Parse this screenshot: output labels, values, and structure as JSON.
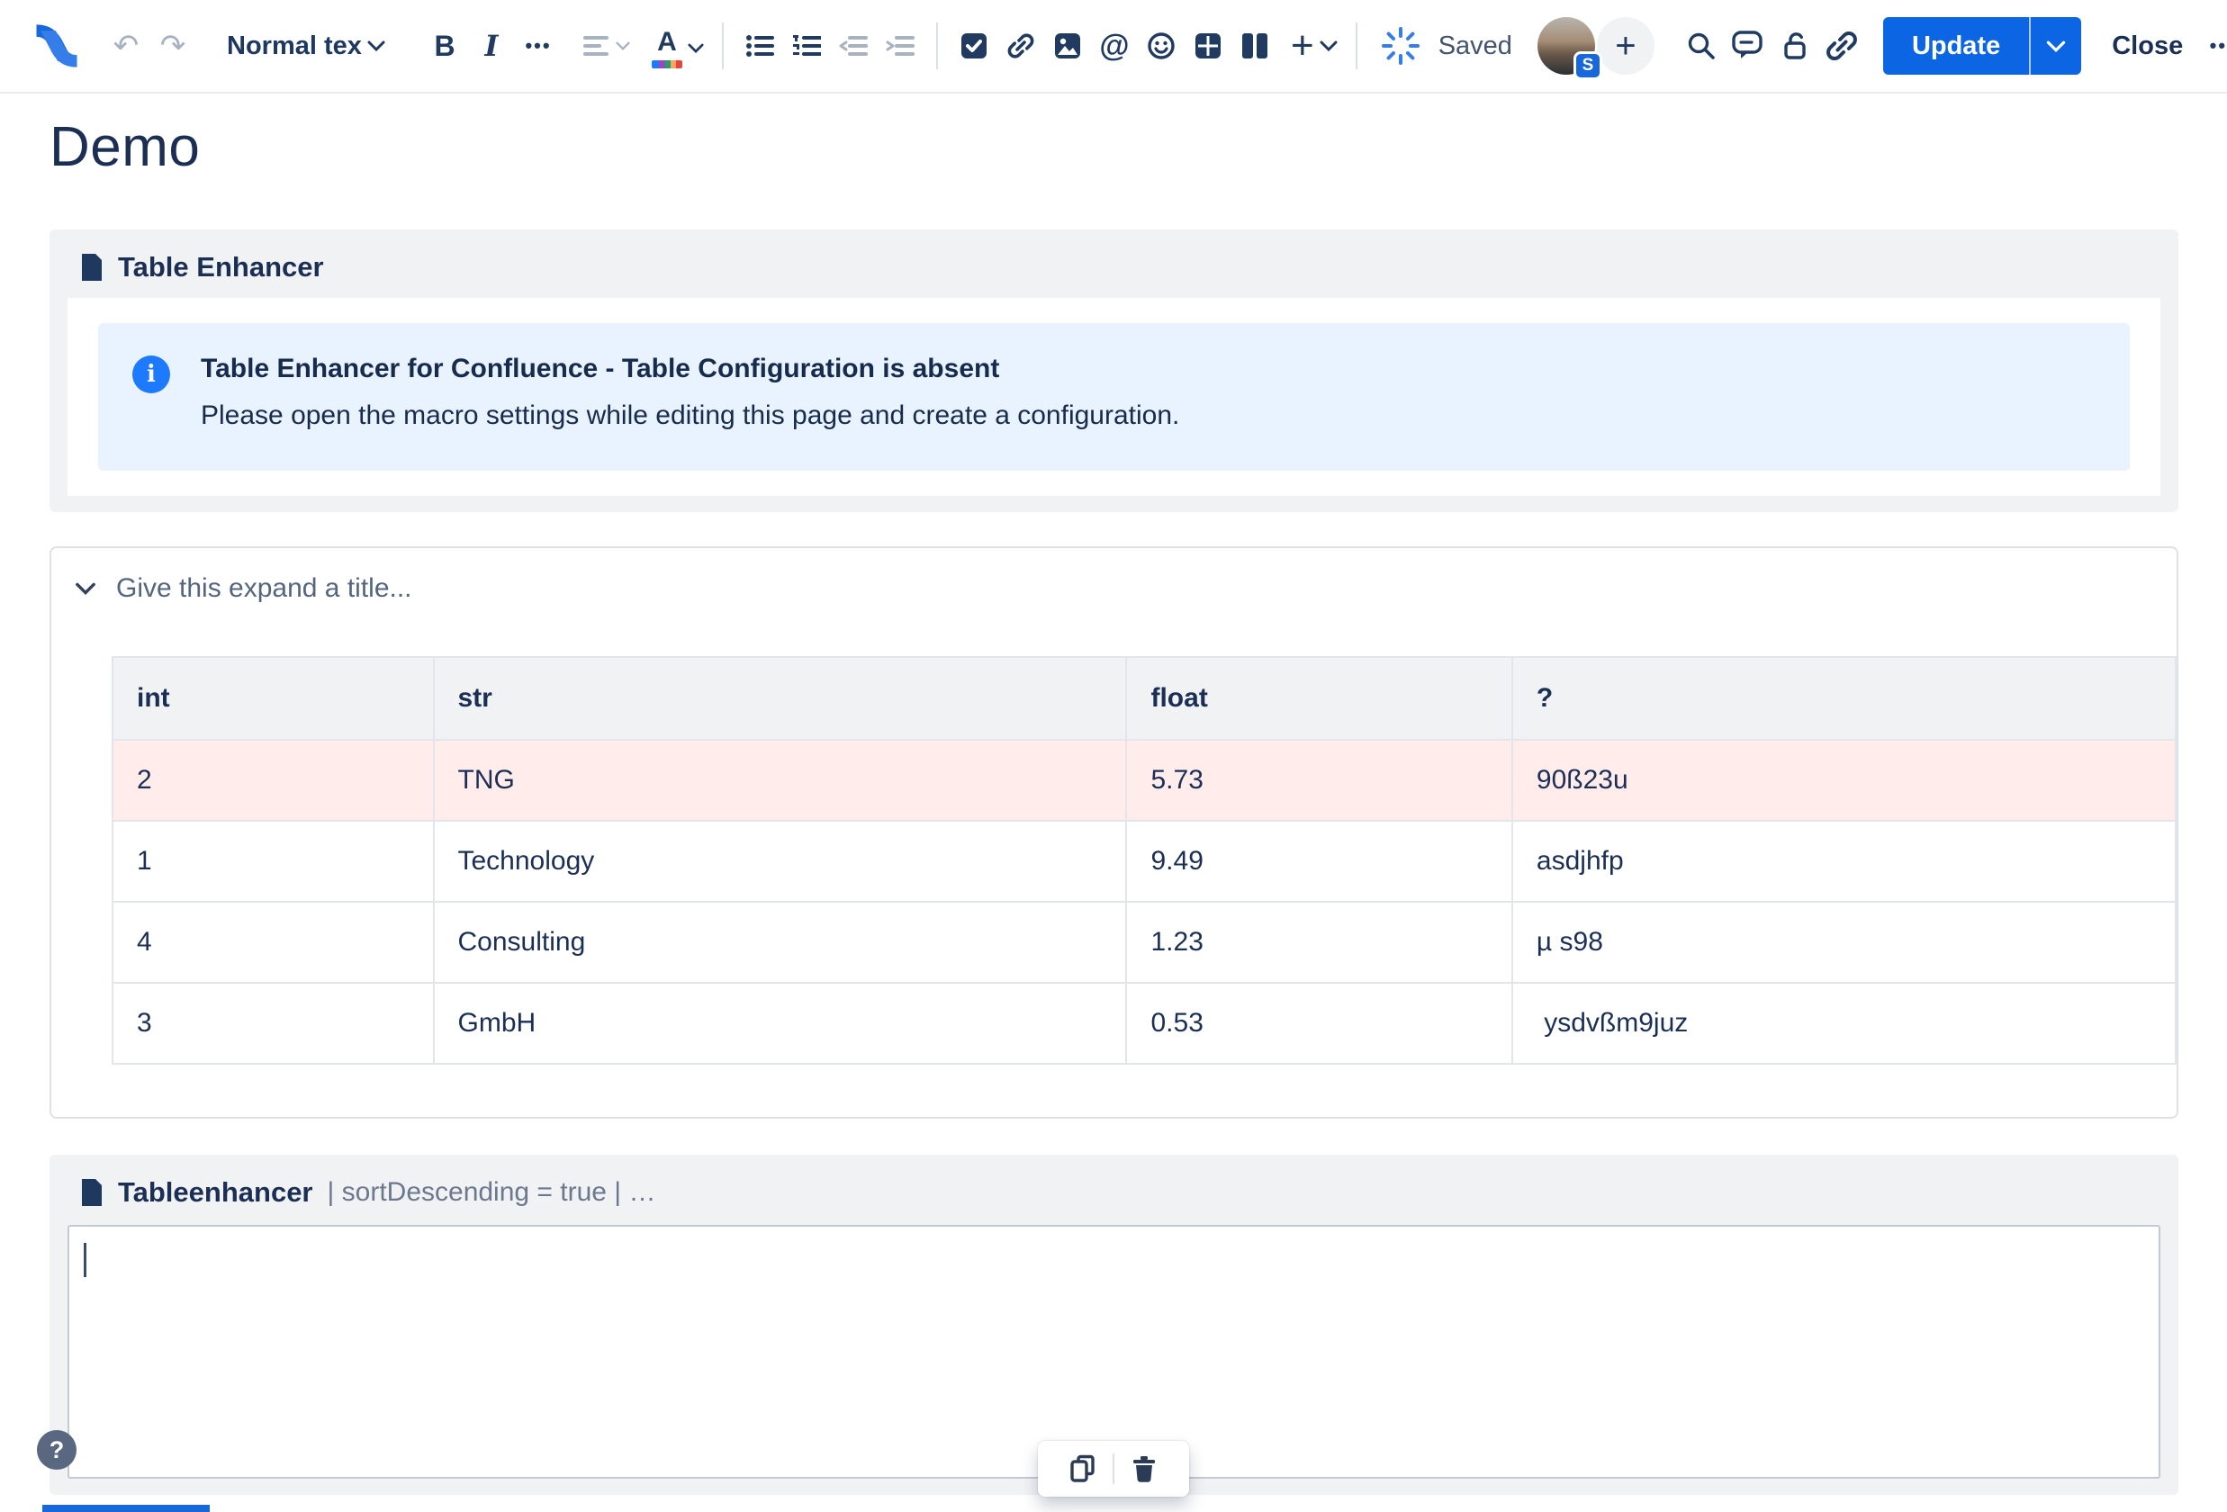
{
  "toolbar": {
    "undo_glyph": "↶",
    "redo_glyph": "↷",
    "text_style_label": "Normal text",
    "bold_label": "B",
    "italic_label": "I",
    "more_formatting_label": "•••",
    "text_color_label": "A",
    "mention_label": "@",
    "plus_label": "+",
    "saved_label": "Saved",
    "avatar_badge": "S",
    "add_collaborator_label": "+",
    "update_label": "Update",
    "close_label": "Close",
    "overflow_label": "•••"
  },
  "page": {
    "title": "Demo"
  },
  "table_enhancer_macro": {
    "name": "Table Enhancer",
    "info": {
      "icon_glyph": "i",
      "title": "Table Enhancer for Confluence - Table Configuration is absent",
      "body": "Please open the macro settings while editing this page and create a configuration."
    }
  },
  "expand": {
    "title_placeholder": "Give this expand a title..."
  },
  "data_table": {
    "headers": [
      "int",
      "str",
      "float",
      "?"
    ],
    "rows": [
      {
        "cells": [
          "2",
          "TNG",
          "5.73",
          "90ß23u"
        ],
        "highlighted": true
      },
      {
        "cells": [
          "1",
          "Technology",
          "9.49",
          "asdjhfp"
        ],
        "highlighted": false
      },
      {
        "cells": [
          "4",
          "Consulting",
          "1.23",
          "µ s98"
        ],
        "highlighted": false
      },
      {
        "cells": [
          "3",
          "GmbH",
          "0.53",
          " ysdvßm9juz"
        ],
        "highlighted": false
      }
    ]
  },
  "tableenhancer_macro": {
    "name": "Tableenhancer",
    "params_text": "| sortDescending = true | …"
  },
  "footer": {
    "help_label": "?"
  },
  "colors": {
    "accent_blue": "#0C66E4",
    "logo_blue": "#1868DB",
    "info_panel_bg": "#E9F2FF",
    "info_icon_blue": "#1D7AFC",
    "highlighted_row_bg": "#FFECEB",
    "macro_panel_bg": "#F1F2F4",
    "table_header_bg": "#F1F2F4",
    "icon_navy": "#203A60",
    "text_dark": "#172B4D",
    "text_subtle": "#626F86"
  }
}
